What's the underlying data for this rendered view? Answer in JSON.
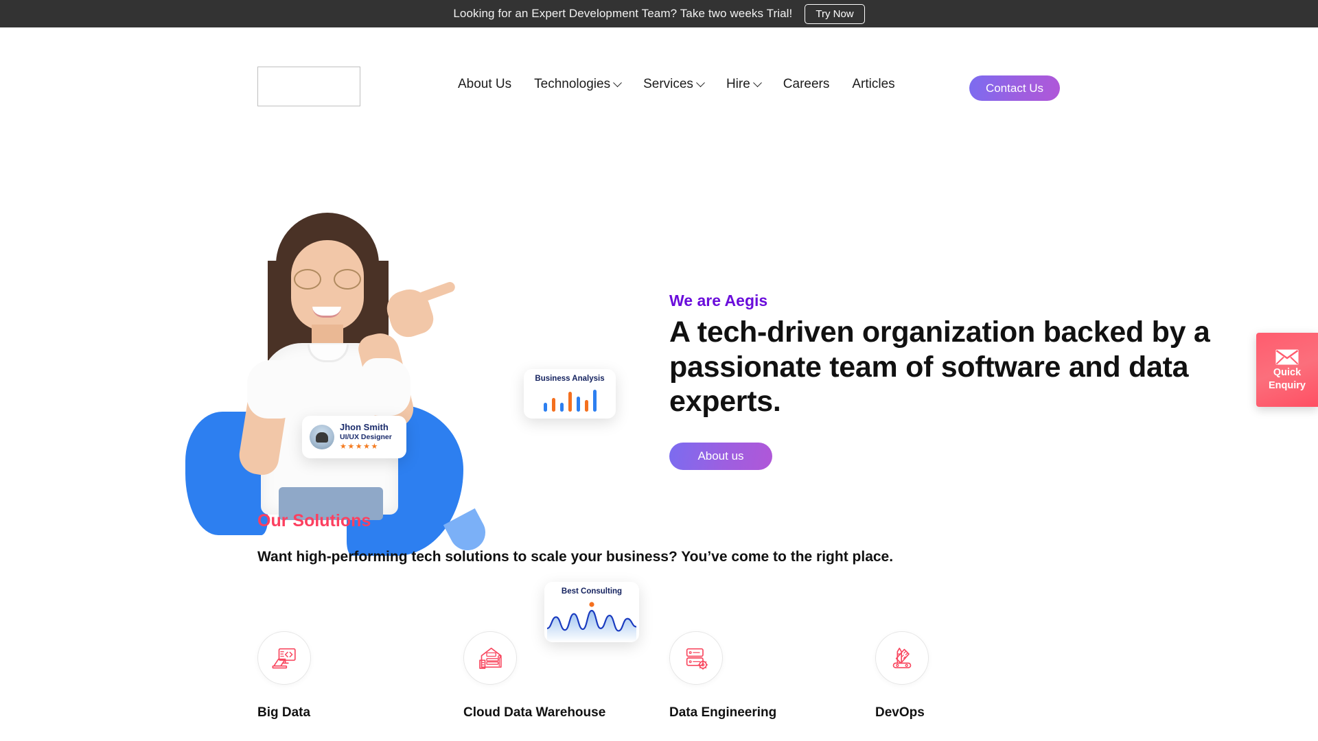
{
  "topbar": {
    "message": "Looking for an Expert Development Team? Take two weeks Trial!",
    "cta_label": "Try Now"
  },
  "header": {
    "logo_alt": "",
    "nav": [
      {
        "label": "About Us",
        "has_dropdown": false
      },
      {
        "label": "Technologies",
        "has_dropdown": true
      },
      {
        "label": "Services",
        "has_dropdown": true
      },
      {
        "label": "Hire",
        "has_dropdown": true
      },
      {
        "label": "Careers",
        "has_dropdown": false
      },
      {
        "label": "Articles",
        "has_dropdown": false
      }
    ],
    "contact_label": "Contact Us"
  },
  "hero": {
    "eyebrow": "We are Aegis",
    "headline": "A tech-driven organization backed by a passionate team of software and data experts.",
    "cta_label": "About us",
    "cards": {
      "person": {
        "name": "Jhon Smith",
        "role": "UI/UX Designer",
        "stars": "★★★★★"
      },
      "analysis": {
        "title": "Business Analysis"
      },
      "consulting": {
        "title": "Best Consulting"
      }
    }
  },
  "enquiry": {
    "line1": "Quick",
    "line2": "Enquiry",
    "icon": "envelope-icon"
  },
  "solutions": {
    "eyebrow": "Our Solutions",
    "subtitle": "Want high-performing tech solutions to scale your business? You’ve come to the right place.",
    "items": [
      {
        "label": "Big Data",
        "icon": "monitor-code-icon"
      },
      {
        "label": "Cloud Data Warehouse",
        "icon": "warehouse-icon"
      },
      {
        "label": "Data Engineering",
        "icon": "server-gear-icon"
      },
      {
        "label": "DevOps",
        "icon": "multi-tool-icon"
      }
    ]
  },
  "colors": {
    "topbar_bg": "#333333",
    "accent_purple": "#6a0ddb",
    "accent_pink": "#fc4060",
    "gradient_purple_start": "#7b6cf0",
    "gradient_purple_end": "#b057d8",
    "enquiry_red": "#ff5c6e",
    "chart_blue": "#2d7ff0",
    "chart_orange": "#f4701f",
    "star_orange": "#f47b20"
  },
  "chart_data": [
    {
      "type": "bar",
      "title": "Business Analysis",
      "categories": [
        "1",
        "2",
        "3",
        "4",
        "5",
        "6",
        "7"
      ],
      "values": [
        14,
        22,
        14,
        32,
        24,
        19,
        36
      ],
      "colors": [
        "#2d7ff0",
        "#f4701f",
        "#2d7ff0",
        "#f4701f",
        "#2d7ff0",
        "#f4701f",
        "#2d7ff0"
      ],
      "xlabel": "",
      "ylabel": "",
      "ylim": [
        0,
        40
      ],
      "grid": false,
      "legend": false
    },
    {
      "type": "area",
      "title": "Best Consulting",
      "x": [
        0,
        1,
        2,
        3,
        4,
        5,
        6,
        7,
        8,
        9,
        10
      ],
      "values": [
        12,
        26,
        10,
        30,
        11,
        34,
        12,
        28,
        9,
        24,
        14
      ],
      "marker": {
        "x": 5,
        "y": 34,
        "color": "#f4701f"
      },
      "line_color": "#1a3bbf",
      "fill_from": "#9cc2f0",
      "fill_to": "#ffffff",
      "xlabel": "",
      "ylabel": "",
      "grid": false,
      "legend": false
    }
  ]
}
